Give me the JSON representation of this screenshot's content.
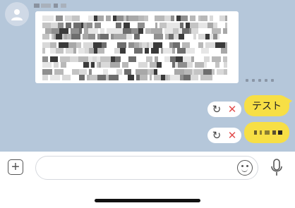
{
  "colors": {
    "chat_background": "#b5c7da",
    "sent_bubble": "#f7df45",
    "received_bubble": "#ffffff",
    "cancel_icon": "#e24d4d"
  },
  "icons": {
    "avatar": "default-user-icon",
    "retry": "retry-icon",
    "cancel": "close-icon",
    "attach": "plus-box-icon",
    "emoji": "smiley-icon",
    "voice": "microphone-icon"
  },
  "messages": {
    "received": {
      "sender_name": "",
      "text": "",
      "time": ""
    },
    "sent": [
      {
        "text": "テスト",
        "status": "failed"
      },
      {
        "text": "",
        "status": "failed"
      }
    ]
  },
  "actions": {
    "retry_glyph": "↻",
    "cancel_glyph": "✕"
  },
  "composer": {
    "attach_glyph": "+",
    "input_value": "",
    "input_placeholder": ""
  }
}
